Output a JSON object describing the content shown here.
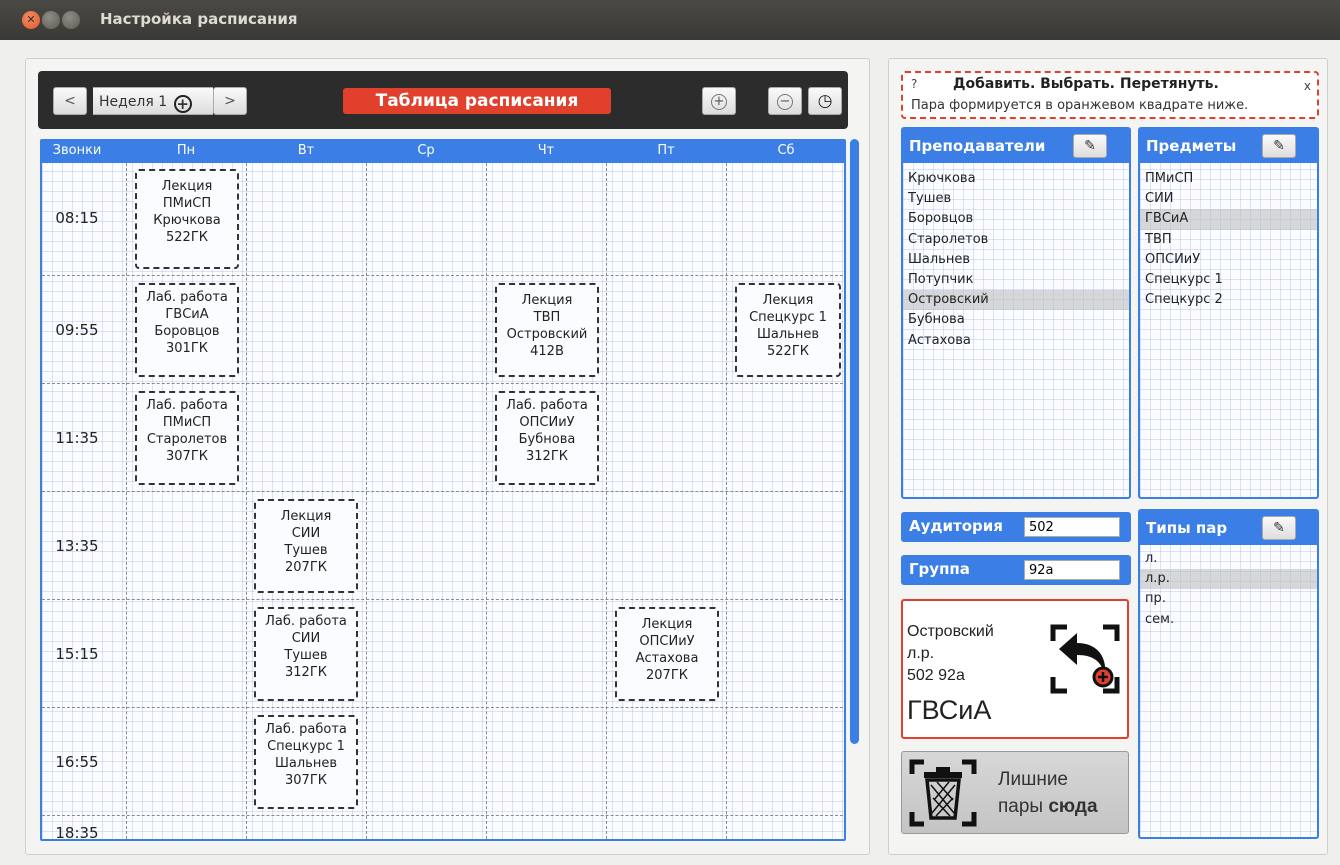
{
  "window": {
    "title": "Настройка расписания"
  },
  "toolbar": {
    "prev_label": "<",
    "week_label": "Неделя 1",
    "week_add_label": "+",
    "next_label": ">",
    "title": "Таблица расписания",
    "zoom_in_label": "+",
    "zoom_out_label": "−",
    "clock_label": "◷"
  },
  "grid": {
    "headers": [
      "Звонки",
      "Пн",
      "Вт",
      "Ср",
      "Чт",
      "Пт",
      "Сб"
    ],
    "times": [
      "08:15",
      "09:55",
      "11:35",
      "13:35",
      "15:15",
      "16:55",
      "18:35"
    ],
    "lessons": [
      {
        "lines": [
          "Лекция",
          "ПМиСП",
          "Крючкова",
          "522ГК"
        ]
      },
      {
        "lines": [
          "Лаб. работа",
          "ГВСиА",
          "Боровцов",
          "301ГК"
        ]
      },
      {
        "lines": [
          "Лекция",
          "ТВП",
          "Островский",
          "412В"
        ]
      },
      {
        "lines": [
          "Лекция",
          "Спецкурс 1",
          "Шальнев",
          "522ГК"
        ]
      },
      {
        "lines": [
          "Лаб. работа",
          "ПМиСП",
          "Старолетов",
          "307ГК"
        ]
      },
      {
        "lines": [
          "Лаб. работа",
          "ОПСИиУ",
          "Бубнова",
          "312ГК"
        ]
      },
      {
        "lines": [
          "Лекция",
          "СИИ",
          "Тушев",
          "207ГК"
        ]
      },
      {
        "lines": [
          "Лаб. работа",
          "СИИ",
          "Тушев",
          "312ГК"
        ]
      },
      {
        "lines": [
          "Лекция",
          "ОПСИиУ",
          "Астахова",
          "207ГК"
        ]
      },
      {
        "lines": [
          "Лаб. работа",
          "Спецкурс 1",
          "Шальнев",
          "307ГК"
        ]
      }
    ]
  },
  "hint": {
    "help": "?",
    "close": "x",
    "headline": "Добавить. Выбрать. Перетянуть.",
    "subtext": "Пара формируется в оранжевом квадрате ниже."
  },
  "teachers": {
    "title": "Преподаватели",
    "items": [
      "Крючкова",
      "Тушев",
      "Боровцов",
      "Старолетов",
      "Шальнев",
      "Потупчик",
      "Островский",
      "Бубнова",
      "Астахова"
    ],
    "selected": "Островский"
  },
  "subjects": {
    "title": "Предметы",
    "items": [
      "ПМиСП",
      "СИИ",
      "ГВСиА",
      "ТВП",
      "ОПСИиУ",
      "Спецкурс 1",
      "Спецкурс 2"
    ],
    "selected": "ГВСиА"
  },
  "room": {
    "label": "Аудитория",
    "value": "502"
  },
  "group": {
    "label": "Группа",
    "value": "92а"
  },
  "pair_types": {
    "title": "Типы пар",
    "items": [
      "л.",
      "л.р.",
      "пр.",
      "сем."
    ],
    "selected": "л.р."
  },
  "pair_preview": {
    "teacher": "Островский",
    "type": "л.р.",
    "room_group": "502 92а",
    "subject": "ГВСиА"
  },
  "trash": {
    "line1": "Лишние",
    "line2a": "пары ",
    "line2b": "сюда"
  },
  "colors": {
    "accent_blue": "#3b7fe6",
    "accent_red": "#e0402c",
    "toolbar_dark": "#2c2c2c"
  },
  "icons": {
    "pencil": "✎"
  }
}
